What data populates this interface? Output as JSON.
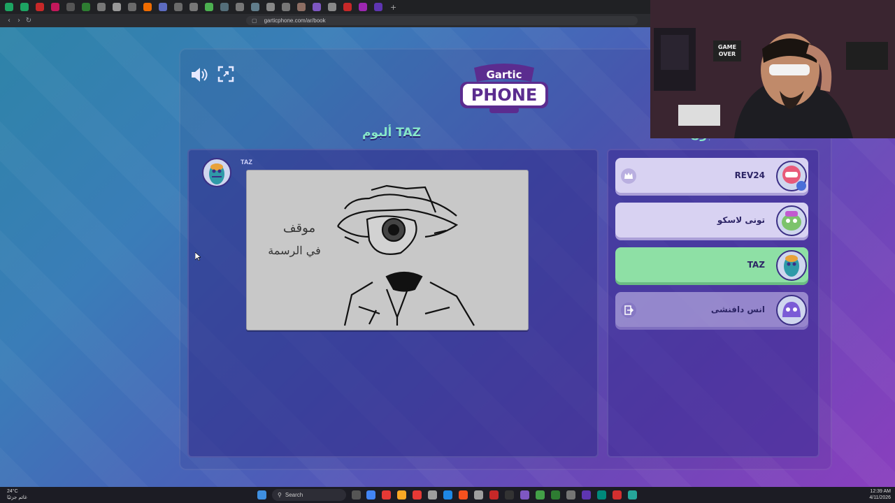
{
  "browser": {
    "url": "garticphone.com/ar/book",
    "tab_colors": [
      "#1da462",
      "#1da462",
      "#c62828",
      "#c2185b",
      "#555",
      "#2e7d32",
      "#777",
      "#999",
      "#6a6a6a",
      "#ef6c00",
      "#5c6bc0",
      "#6a6a6a",
      "#777",
      "#4caf50",
      "#546e7a",
      "#777",
      "#607d8b",
      "#888",
      "#777",
      "#8d6e63",
      "#7e57c2",
      "#888",
      "#c62828",
      "#9c27b0",
      "#5e35b1"
    ]
  },
  "game": {
    "logo_line1": "Gartic",
    "logo_line2": "PHONE",
    "album_title": "ألبوم TAZ",
    "players_heading": "اللاعبون",
    "message": {
      "author": "TAZ",
      "drawing_text_line1": "موقف",
      "drawing_text_line2": "في الرسمة"
    },
    "players": [
      {
        "name": "REV24",
        "status": "host",
        "row_icon": "crown-icon",
        "avatar_color": "#e85a7a"
      },
      {
        "name": "تونى لاسكو",
        "status": "normal",
        "row_icon": "",
        "avatar_color": "#7cc36c"
      },
      {
        "name": "TAZ",
        "status": "active",
        "row_icon": "",
        "avatar_color": "#2f9aa8"
      },
      {
        "name": "انس دافنشى",
        "status": "left",
        "row_icon": "exit-icon",
        "avatar_color": "#7b5bd6"
      }
    ]
  },
  "webcam": {
    "poster_text_line1": "GAME",
    "poster_text_line2": "OVER"
  },
  "taskbar": {
    "weather_temp": "24°C",
    "weather_desc": "غائم جزئيًا",
    "search_label": "Search",
    "time": "12:39 AM",
    "date": "4/11/2026"
  }
}
